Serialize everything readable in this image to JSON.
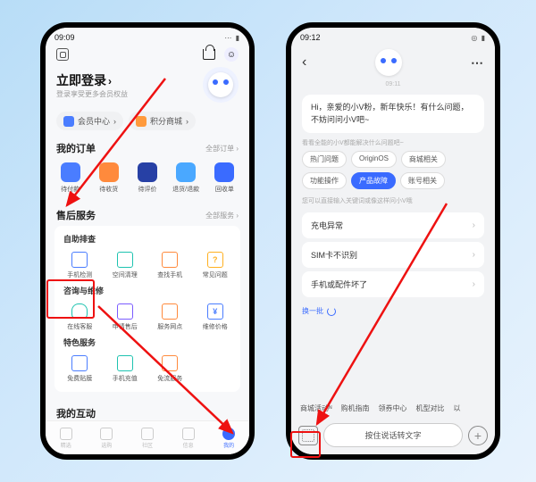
{
  "left": {
    "status": {
      "time": "09:09",
      "icons_l": "⌖ ⓘ ⬙",
      "icons_r": "⋯ ▮"
    },
    "login": {
      "title": "立即登录",
      "chev": "›",
      "sub": "登录享受更多会员权益"
    },
    "pills": {
      "member": "会员中心",
      "points": "积分商城",
      "chev": "›"
    },
    "orders": {
      "title": "我的订单",
      "more": "全部订单 ›",
      "items": [
        {
          "label": "待付款"
        },
        {
          "label": "待收货"
        },
        {
          "label": "待评价"
        },
        {
          "label": "退货/退款"
        },
        {
          "label": "回收单"
        }
      ]
    },
    "aftersale": {
      "title": "售后服务",
      "more": "全部服务 ›",
      "group1": {
        "title": "自助排查",
        "items": [
          "手机检测",
          "空间清理",
          "查找手机",
          "常见问题"
        ]
      },
      "group2": {
        "title": "咨询与维修",
        "items": [
          "在线客服",
          "申请售后",
          "服务网点",
          "维修价格"
        ]
      },
      "group3": {
        "title": "特色服务",
        "items": [
          "免费贴膜",
          "手机充值",
          "免流服务"
        ]
      }
    },
    "interact": {
      "title": "我的互动"
    },
    "tabs": [
      "精选",
      "选购",
      "社区",
      "信息",
      "我的"
    ]
  },
  "right": {
    "status": {
      "time": "09:12",
      "icons_l": "● ⬙ ◐ ⬙",
      "icons_r": "◎ ▮"
    },
    "timestamp": "09:11",
    "greeting": "Hi，亲爱的小V粉，新年快乐！有什么问题，不妨问问小V吧~",
    "chip_intro": "看看全能的小V都能解决什么问题吧~",
    "chips": [
      "热门问题",
      "OriginOS",
      "商城相关",
      "功能操作",
      "产品故障",
      "账号相关"
    ],
    "tip": "您可以直接输入关键词或像这样问小V哦",
    "list": [
      "充电异常",
      "SIM卡不识别",
      "手机或配件坏了"
    ],
    "refresh": "换一批",
    "quick": [
      "商城活动ᴺ",
      "购机指南",
      "领券中心",
      "机型对比",
      "以"
    ],
    "voice": "按住说话转文字"
  }
}
